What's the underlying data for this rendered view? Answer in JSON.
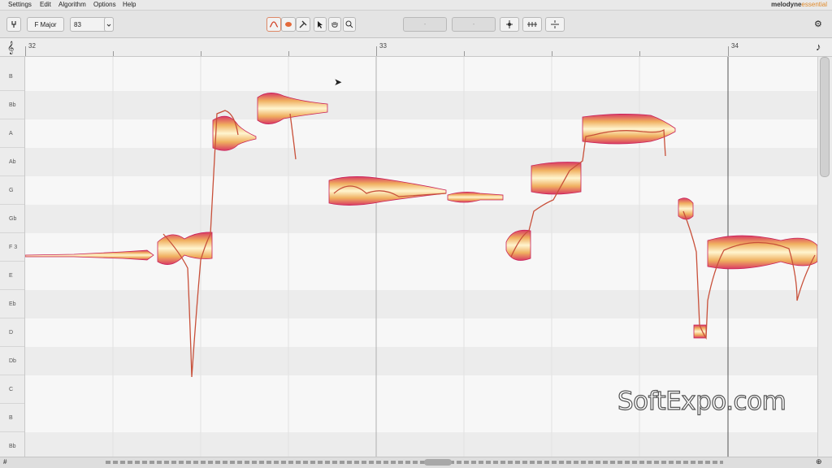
{
  "menu": [
    "Settings",
    "Edit",
    "Algorithm",
    "Options",
    "Help"
  ],
  "logo": {
    "brand": "melodyne",
    "edition": "essential"
  },
  "toolbar": {
    "scale": "F Major",
    "tempo": "83",
    "field_a": "-",
    "field_b": "-"
  },
  "ruler": {
    "bars": [
      {
        "label": "32"
      },
      {
        "label": "33"
      },
      {
        "label": "34"
      }
    ]
  },
  "pitch_labels": [
    "B",
    "Bb",
    "A",
    "Ab",
    "G",
    "Gb",
    "F 3",
    "E",
    "Eb",
    "D",
    "Db",
    "C",
    "B",
    "Bb"
  ],
  "colors": {
    "blob_light": "#fff2c8",
    "blob_mid": "#f0b860",
    "blob_edge": "#c8205a",
    "pitch_curve": "#c8503a"
  },
  "watermark": "SoftExpo.com"
}
